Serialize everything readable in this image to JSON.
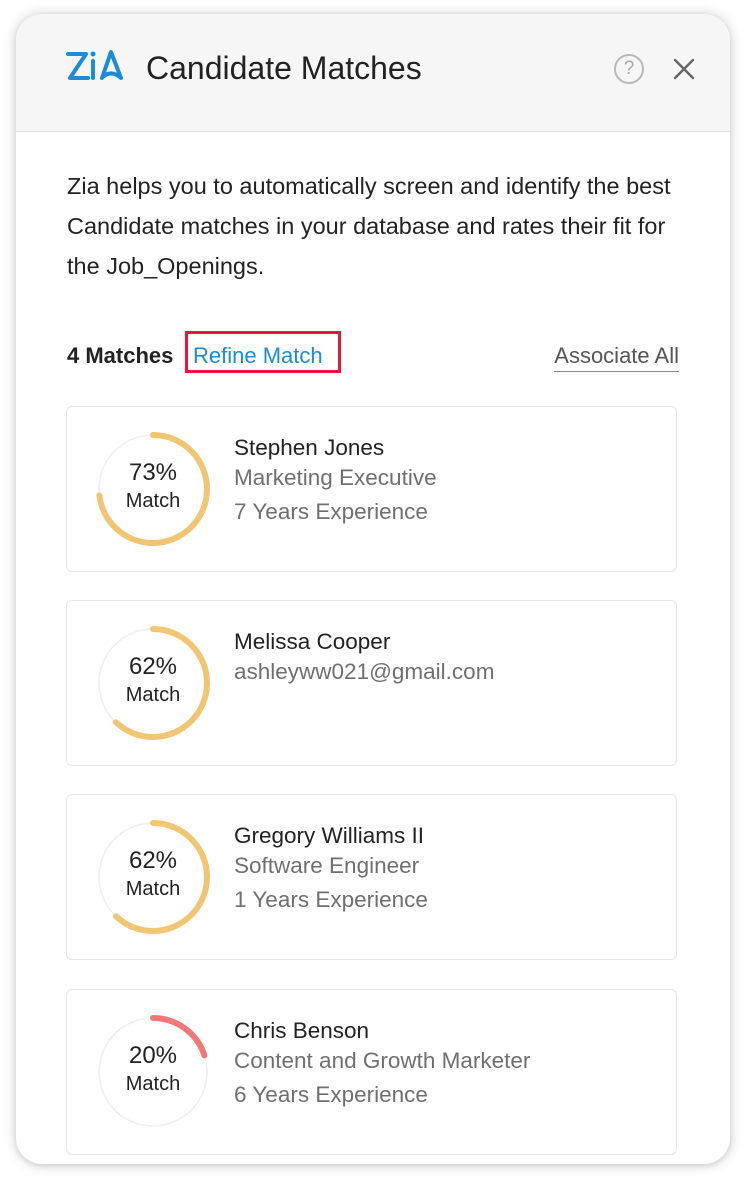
{
  "header": {
    "title": "Candidate Matches",
    "help_glyph": "?",
    "icons": [
      "zia-logo-icon",
      "help-icon",
      "close-icon"
    ],
    "logo_color": "#1a8cd8"
  },
  "description": "Zia helps you to automatically screen and identify the best Candidate matches in your database and rates their fit for the Job_Openings.",
  "summary": {
    "matches_count_label": "4 Matches",
    "refine_label": "Refine Match",
    "associate_all_label": "Associate All",
    "refine_highlight_color": "#e5173f",
    "link_color": "#1a8cd8"
  },
  "match_word": "Match",
  "candidates": [
    {
      "name": "Stephen Jones",
      "line2": "Marketing Executive",
      "line3": "7 Years Experience",
      "percent": 73,
      "percent_label": "73%",
      "ring_color": "#f0c674"
    },
    {
      "name": "Melissa Cooper",
      "line2": "ashleyww021@gmail.com",
      "line3": "",
      "percent": 62,
      "percent_label": "62%",
      "ring_color": "#f0c674"
    },
    {
      "name": "Gregory Williams II",
      "line2": "Software Engineer",
      "line3": "1 Years Experience",
      "percent": 62,
      "percent_label": "62%",
      "ring_color": "#f0c674"
    },
    {
      "name": "Chris Benson",
      "line2": "Content and Growth Marketer",
      "line3": "6 Years Experience",
      "percent": 20,
      "percent_label": "20%",
      "ring_color": "#f07878"
    }
  ]
}
